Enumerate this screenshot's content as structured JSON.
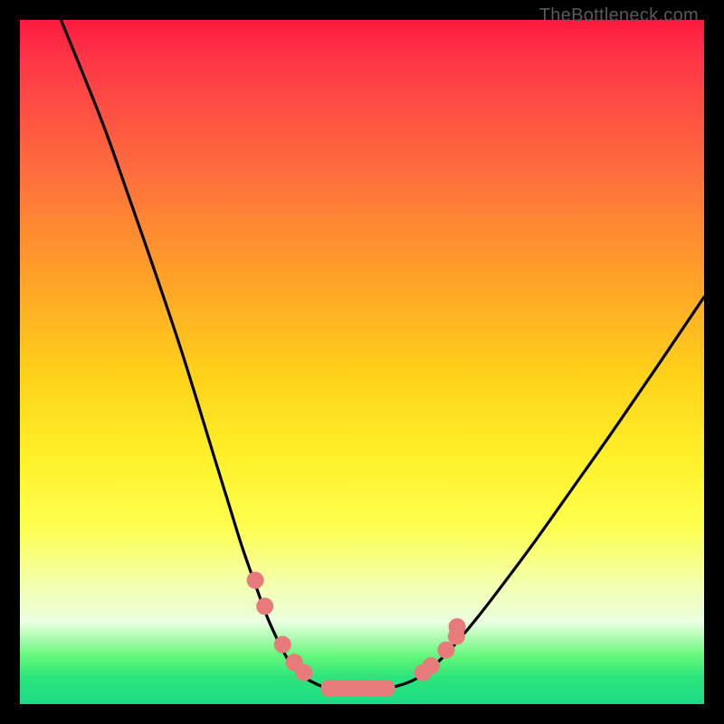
{
  "watermark": "TheBottleneck.com",
  "chart_data": {
    "type": "line",
    "title": "",
    "xlabel": "",
    "ylabel": "",
    "xlim": [
      0,
      100
    ],
    "ylim": [
      0,
      100
    ],
    "series": [
      {
        "name": "left-curve",
        "x": [
          6,
          11.9,
          15.9,
          19.8,
          23.2,
          25.9,
          28.4,
          30.6,
          32.5,
          34.4,
          36.2,
          38.0,
          39.5,
          41.1,
          42.6,
          45.1,
          47.9,
          50.0
        ],
        "y": [
          100,
          85.4,
          74.2,
          63.0,
          52.9,
          44.3,
          36.1,
          29.0,
          22.9,
          17.5,
          12.6,
          8.7,
          6.0,
          4.3,
          3.3,
          2.3,
          2.3,
          2.3
        ]
      },
      {
        "name": "right-curve",
        "x": [
          50.0,
          52.5,
          55.0,
          57.9,
          60.5,
          63.2,
          66.9,
          70.9,
          75.5,
          80.6,
          86.1,
          92.7,
          100
        ],
        "y": [
          2.3,
          2.3,
          2.6,
          3.7,
          5.6,
          8.3,
          12.7,
          17.9,
          24.1,
          31.3,
          39.1,
          48.7,
          59.5
        ]
      }
    ],
    "markers": {
      "name": "dots",
      "color": "#e77a7a",
      "points": [
        {
          "x": 34.4,
          "y": 18.1
        },
        {
          "x": 35.8,
          "y": 14.3
        },
        {
          "x": 38.4,
          "y": 8.7
        },
        {
          "x": 40.1,
          "y": 6.1
        },
        {
          "x": 41.5,
          "y": 4.6
        },
        {
          "x": 45.5,
          "y": 2.3
        },
        {
          "x": 48.4,
          "y": 2.3
        },
        {
          "x": 51.3,
          "y": 2.3
        },
        {
          "x": 53.6,
          "y": 2.3
        },
        {
          "x": 58.9,
          "y": 4.6
        },
        {
          "x": 60.1,
          "y": 5.6
        },
        {
          "x": 62.3,
          "y": 7.9
        },
        {
          "x": 63.8,
          "y": 9.9
        },
        {
          "x": 63.9,
          "y": 11.3
        }
      ]
    },
    "plateau_bar": {
      "color": "#e77a7a",
      "x0": 44.0,
      "x1": 54.6,
      "y": 2.3,
      "thickness": 2.4
    }
  }
}
